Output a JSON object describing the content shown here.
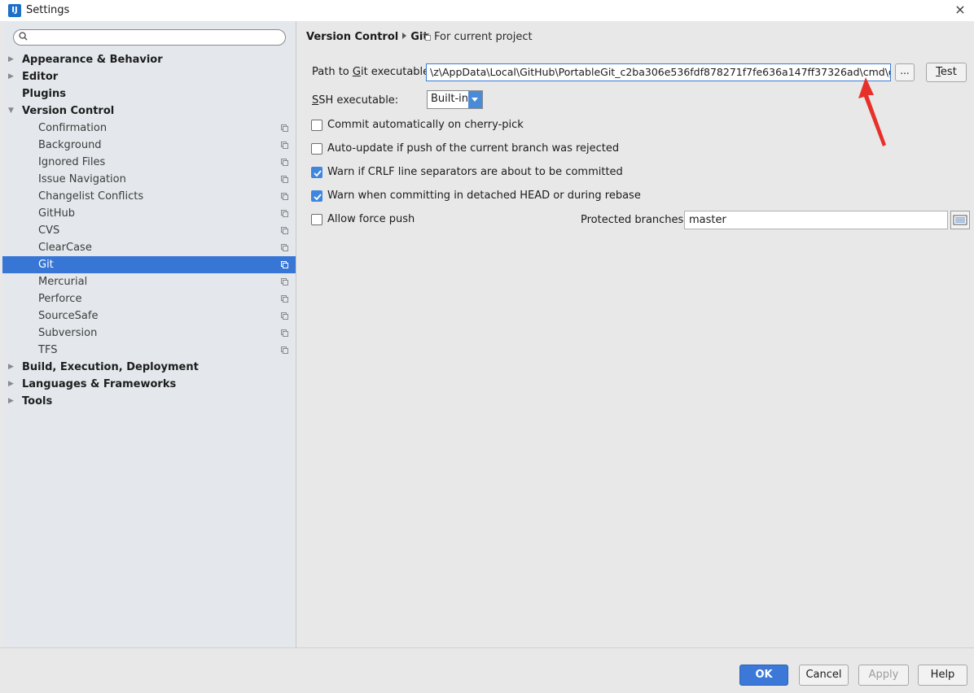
{
  "window": {
    "title": "Settings",
    "icon": "intellij-icon",
    "close": "×"
  },
  "search": {
    "placeholder": "",
    "icon": "search-icon"
  },
  "tree": [
    {
      "label": "Appearance & Behavior",
      "level": 0,
      "expandable": true,
      "expanded": false
    },
    {
      "label": "Editor",
      "level": 0,
      "expandable": true,
      "expanded": false
    },
    {
      "label": "Plugins",
      "level": 0,
      "expandable": false
    },
    {
      "label": "Version Control",
      "level": 0,
      "expandable": true,
      "expanded": true
    },
    {
      "label": "Confirmation",
      "level": 1
    },
    {
      "label": "Background",
      "level": 1
    },
    {
      "label": "Ignored Files",
      "level": 1
    },
    {
      "label": "Issue Navigation",
      "level": 1
    },
    {
      "label": "Changelist Conflicts",
      "level": 1
    },
    {
      "label": "GitHub",
      "level": 1
    },
    {
      "label": "CVS",
      "level": 1
    },
    {
      "label": "ClearCase",
      "level": 1
    },
    {
      "label": "Git",
      "level": 1,
      "selected": true
    },
    {
      "label": "Mercurial",
      "level": 1
    },
    {
      "label": "Perforce",
      "level": 1
    },
    {
      "label": "SourceSafe",
      "level": 1
    },
    {
      "label": "Subversion",
      "level": 1
    },
    {
      "label": "TFS",
      "level": 1
    },
    {
      "label": "Build, Execution, Deployment",
      "level": 0,
      "expandable": true,
      "expanded": false
    },
    {
      "label": "Languages & Frameworks",
      "level": 0,
      "expandable": true,
      "expanded": false
    },
    {
      "label": "Tools",
      "level": 0,
      "expandable": true,
      "expanded": false
    }
  ],
  "main": {
    "breadcrumb": {
      "parent": "Version Control",
      "current": "Git"
    },
    "for_project": "For current project",
    "path_label": "Path to Git executable:",
    "path_value": "\\z\\AppData\\Local\\GitHub\\PortableGit_c2ba306e536fdf878271f7fe636a147ff37326ad\\cmd\\git.exe",
    "browse_label": "...",
    "test_label": "Test",
    "ssh_label": "SSH executable:",
    "ssh_value": "Built-in",
    "options": [
      {
        "label": "Commit automatically on cherry-pick",
        "checked": false
      },
      {
        "label": "Auto-update if push of the current branch was rejected",
        "checked": false
      },
      {
        "label": "Warn if CRLF line separators are about to be committed",
        "checked": true
      },
      {
        "label": "Warn when committing in detached HEAD or during rebase",
        "checked": true
      },
      {
        "label": "Allow force push",
        "checked": false
      }
    ],
    "protected_label": "Protected branches:",
    "protected_value": "master"
  },
  "footer": {
    "ok": "OK",
    "cancel": "Cancel",
    "apply": "Apply",
    "help": "Help"
  },
  "colors": {
    "accent": "#3876d5",
    "annotation": "#e8302a"
  }
}
